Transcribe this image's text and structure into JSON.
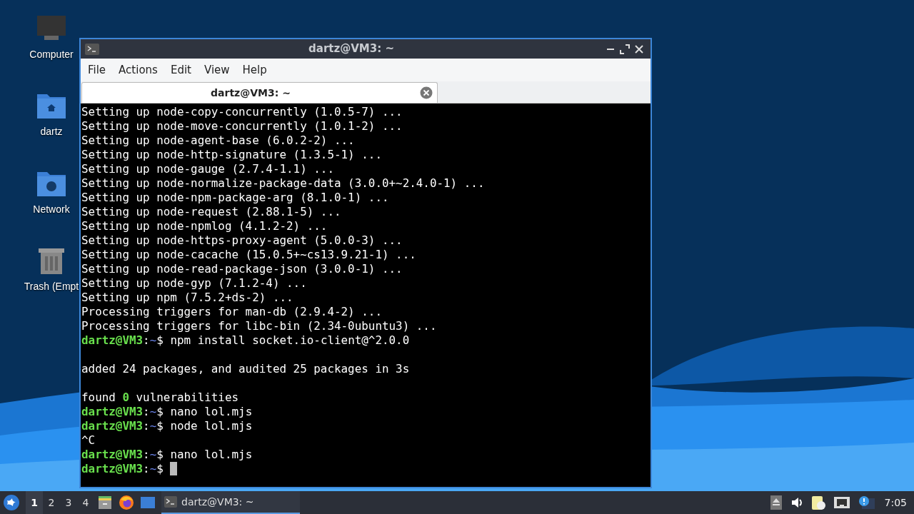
{
  "desktop_icons": [
    {
      "label": "Computer",
      "kind": "computer"
    },
    {
      "label": "dartz",
      "kind": "home"
    },
    {
      "label": "Network",
      "kind": "network"
    },
    {
      "label": "Trash (Empt",
      "kind": "trash"
    }
  ],
  "window": {
    "title": "dartz@VM3: ~",
    "menu": [
      "File",
      "Actions",
      "Edit",
      "View",
      "Help"
    ],
    "tabs": [
      {
        "label": "dartz@VM3: ~",
        "selected": true
      }
    ],
    "lines": [
      {
        "kind": "output",
        "text": "Setting up node-copy-concurrently (1.0.5-7) ..."
      },
      {
        "kind": "output",
        "text": "Setting up node-move-concurrently (1.0.1-2) ..."
      },
      {
        "kind": "output",
        "text": "Setting up node-agent-base (6.0.2-2) ..."
      },
      {
        "kind": "output",
        "text": "Setting up node-http-signature (1.3.5-1) ..."
      },
      {
        "kind": "output",
        "text": "Setting up node-gauge (2.7.4-1.1) ..."
      },
      {
        "kind": "output",
        "text": "Setting up node-normalize-package-data (3.0.0+~2.4.0-1) ..."
      },
      {
        "kind": "output",
        "text": "Setting up node-npm-package-arg (8.1.0-1) ..."
      },
      {
        "kind": "output",
        "text": "Setting up node-request (2.88.1-5) ..."
      },
      {
        "kind": "output",
        "text": "Setting up node-npmlog (4.1.2-2) ..."
      },
      {
        "kind": "output",
        "text": "Setting up node-https-proxy-agent (5.0.0-3) ..."
      },
      {
        "kind": "output",
        "text": "Setting up node-cacache (15.0.5+~cs13.9.21-1) ..."
      },
      {
        "kind": "output",
        "text": "Setting up node-read-package-json (3.0.0-1) ..."
      },
      {
        "kind": "output",
        "text": "Setting up node-gyp (7.1.2-4) ..."
      },
      {
        "kind": "output",
        "text": "Setting up npm (7.5.2+ds-2) ..."
      },
      {
        "kind": "output",
        "text": "Processing triggers for man-db (2.9.4-2) ..."
      },
      {
        "kind": "output",
        "text": "Processing triggers for libc-bin (2.34-0ubuntu3) ..."
      },
      {
        "kind": "prompt",
        "user": "dartz@VM3",
        "separator": ":",
        "path": "~",
        "symbol": "$",
        "command": "npm install socket.io-client@^2.0.0"
      },
      {
        "kind": "blank"
      },
      {
        "kind": "output",
        "text": "added 24 packages, and audited 25 packages in 3s"
      },
      {
        "kind": "blank"
      },
      {
        "kind": "output",
        "text": "found **0** vulnerabilities"
      },
      {
        "kind": "prompt",
        "user": "dartz@VM3",
        "separator": ":",
        "path": "~",
        "symbol": "$",
        "command": "nano lol.mjs"
      },
      {
        "kind": "prompt",
        "user": "dartz@VM3",
        "separator": ":",
        "path": "~",
        "symbol": "$",
        "command": "node lol.mjs"
      },
      {
        "kind": "output",
        "text": "^C"
      },
      {
        "kind": "prompt",
        "user": "dartz@VM3",
        "separator": ":",
        "path": "~",
        "symbol": "$",
        "command": "nano lol.mjs"
      },
      {
        "kind": "prompt",
        "user": "dartz@VM3",
        "separator": ":",
        "path": "~",
        "symbol": "$",
        "cursor": true
      }
    ]
  },
  "taskbar": {
    "workspaces": [
      {
        "label": "1",
        "selected": true
      },
      {
        "label": "2",
        "selected": false
      },
      {
        "label": "3",
        "selected": false
      },
      {
        "label": "4",
        "selected": false
      }
    ],
    "tasks": [
      {
        "label": "dartz@VM3: ~",
        "selected": true
      }
    ],
    "clock": "7:05"
  }
}
